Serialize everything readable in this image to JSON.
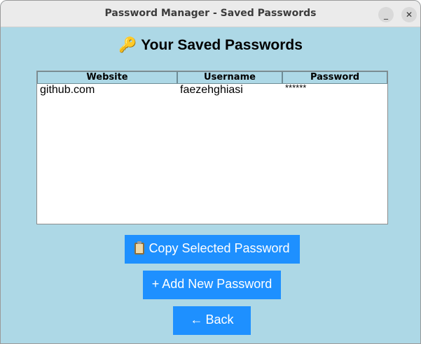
{
  "window": {
    "title": "Password Manager - Saved Passwords",
    "minimize_glyph": "_",
    "close_glyph": "✕"
  },
  "heading": {
    "icon": "🔑",
    "icon_name": "key-icon",
    "text": "Your Saved Passwords"
  },
  "table": {
    "columns": [
      "Website",
      "Username",
      "Password"
    ],
    "rows": [
      [
        "github.com",
        "faezehghiasi",
        "******"
      ]
    ]
  },
  "buttons": {
    "copy": {
      "icon_name": "clipboard-icon",
      "label": "Copy Selected Password"
    },
    "add": {
      "icon": "+",
      "icon_name": "plus-icon",
      "label": "Add New Password"
    },
    "back": {
      "icon": "←",
      "icon_name": "back-arrow-icon",
      "label": "Back"
    }
  },
  "colors": {
    "background": "#add8e6",
    "button": "#1e90ff",
    "button_text": "#ffffff",
    "header_bg": "#add8e6"
  }
}
